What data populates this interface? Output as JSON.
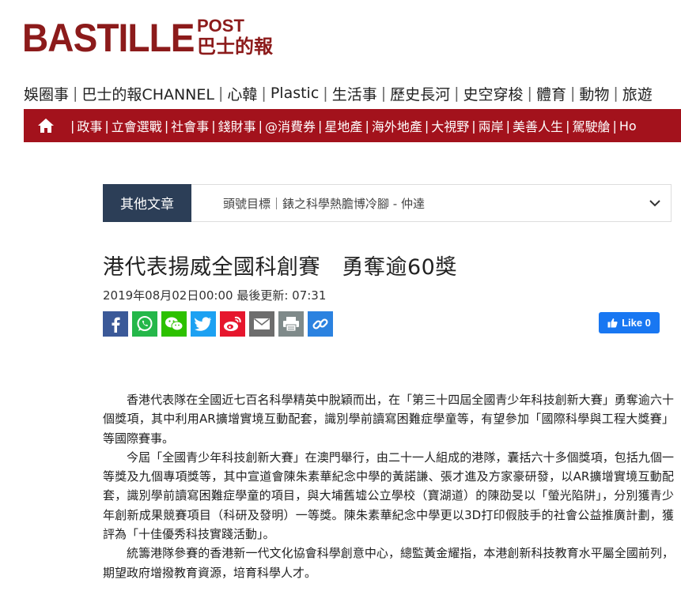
{
  "logo": {
    "main": "BASTILLE",
    "post": "POST",
    "sub": "巴士的報"
  },
  "topnav": [
    "娛圈事",
    "巴士的報CHANNEL",
    "心韓",
    "Plastic",
    "生活事",
    "歷史長河",
    "史空穿梭",
    "體育",
    "動物",
    "旅遊"
  ],
  "rednav": [
    "政事",
    "立會選戰",
    "社會事",
    "錢財事",
    "@消費券",
    "星地產",
    "海外地產",
    "大視野",
    "兩岸",
    "美善人生",
    "駕駛艙",
    "Ho"
  ],
  "other": {
    "label": "其他文章",
    "text": "頭號目標｜錶之科學熱膽博冷腳 - 仲達"
  },
  "article": {
    "title": "港代表揚威全國科創賽　勇奪逾60獎",
    "date": "2019年08月02日00:00 最後更新: 07:31",
    "like_label": "Like 0",
    "paragraphs": [
      "香港代表隊在全國近七百名科學精英中脫穎而出，在「第三十四屆全國青少年科技創新大賽」勇奪逾六十個獎項，其中利用AR擴增實境互動配套，識別學前讀寫困難症學童等，有望參加「國際科學與工程大獎賽」等國際賽事。",
      "今屆「全國青少年科技創新大賽」在澳門舉行，由二十一人組成的港隊，囊括六十多個獎項，包括九個一等獎及九個專項獎等，其中宣道會陳朱素華紀念中學的黃諾謙、張才進及方家豪研發，以AR擴增實境互動配套，識別學前讀寫困難症學童的項目，與大埔舊墟公立學校（寶湖道）的陳劭旻以「螢光陷阱」，分別獲青少年創新成果競賽項目（科研及發明）一等獎。陳朱素華紀念中學更以3D打印假肢手的社會公益推廣計劃，獲評為「十佳優秀科技實踐活動」。",
      "統籌港隊參賽的香港新一代文化協會科學創意中心，總監黃金耀指，本港創新科技教育水平屬全國前列，期望政府增撥教育資源，培育科學人才。"
    ]
  },
  "share_icons": [
    {
      "name": "facebook-icon",
      "color": "#3b5998"
    },
    {
      "name": "whatsapp-icon",
      "color": "#25b74a"
    },
    {
      "name": "wechat-icon",
      "color": "#2dc100"
    },
    {
      "name": "twitter-icon",
      "color": "#1da1f2"
    },
    {
      "name": "weibo-icon",
      "color": "#e6162d"
    },
    {
      "name": "email-icon",
      "color": "#6d6d6d"
    },
    {
      "name": "print-icon",
      "color": "#7f8a8a"
    },
    {
      "name": "link-icon",
      "color": "#2b82e0"
    }
  ],
  "colors": {
    "brand": "#8c1b1b",
    "nav_red": "#a3121c",
    "other_label_bg": "#2c3e57",
    "like_blue": "#1877f2"
  }
}
